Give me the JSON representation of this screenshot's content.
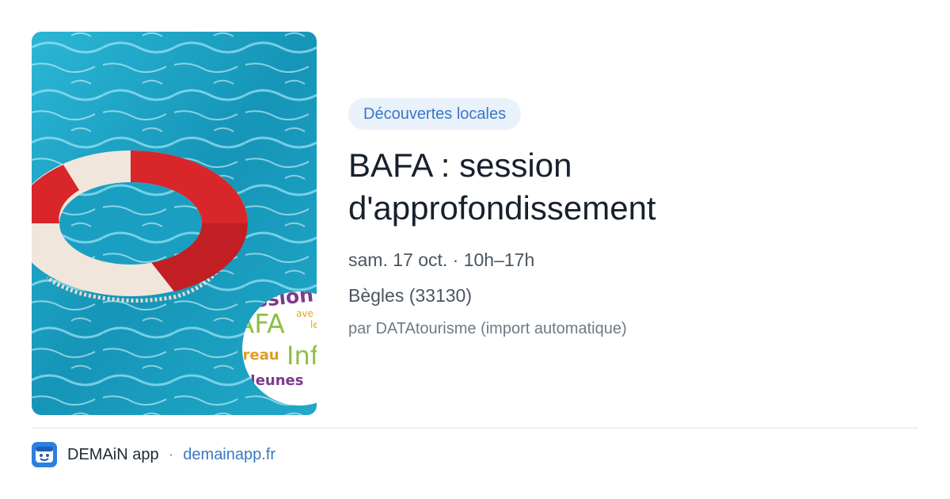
{
  "event": {
    "category": "Découvertes locales",
    "title_line1": "BAFA : session",
    "title_line2": "d'approfondissement",
    "date_time": "sam. 17 oct. · 10h–17h",
    "location": "Bègles (33130)",
    "source": "par DATAtourisme (import automatique)",
    "image": {
      "description_icon": "lifebuoy-in-pool-image",
      "sticker": {
        "line1": "Session",
        "line2": "BAFA",
        "line2_side": "ave le",
        "line3": "Bureau",
        "line3_side": "Info",
        "line4": "Jeunes"
      }
    }
  },
  "footer": {
    "app_name": "DEMAiN app",
    "separator": "·",
    "domain": "demainapp.fr",
    "icon": "demain-app-icon"
  },
  "colors": {
    "accent": "#3a78c3",
    "badge_bg": "#e9f1fb",
    "title": "#17212d",
    "pool": "#1fa3c4",
    "lifebuoy_red": "#d8262b",
    "lifebuoy_white": "#f1e6dc"
  }
}
